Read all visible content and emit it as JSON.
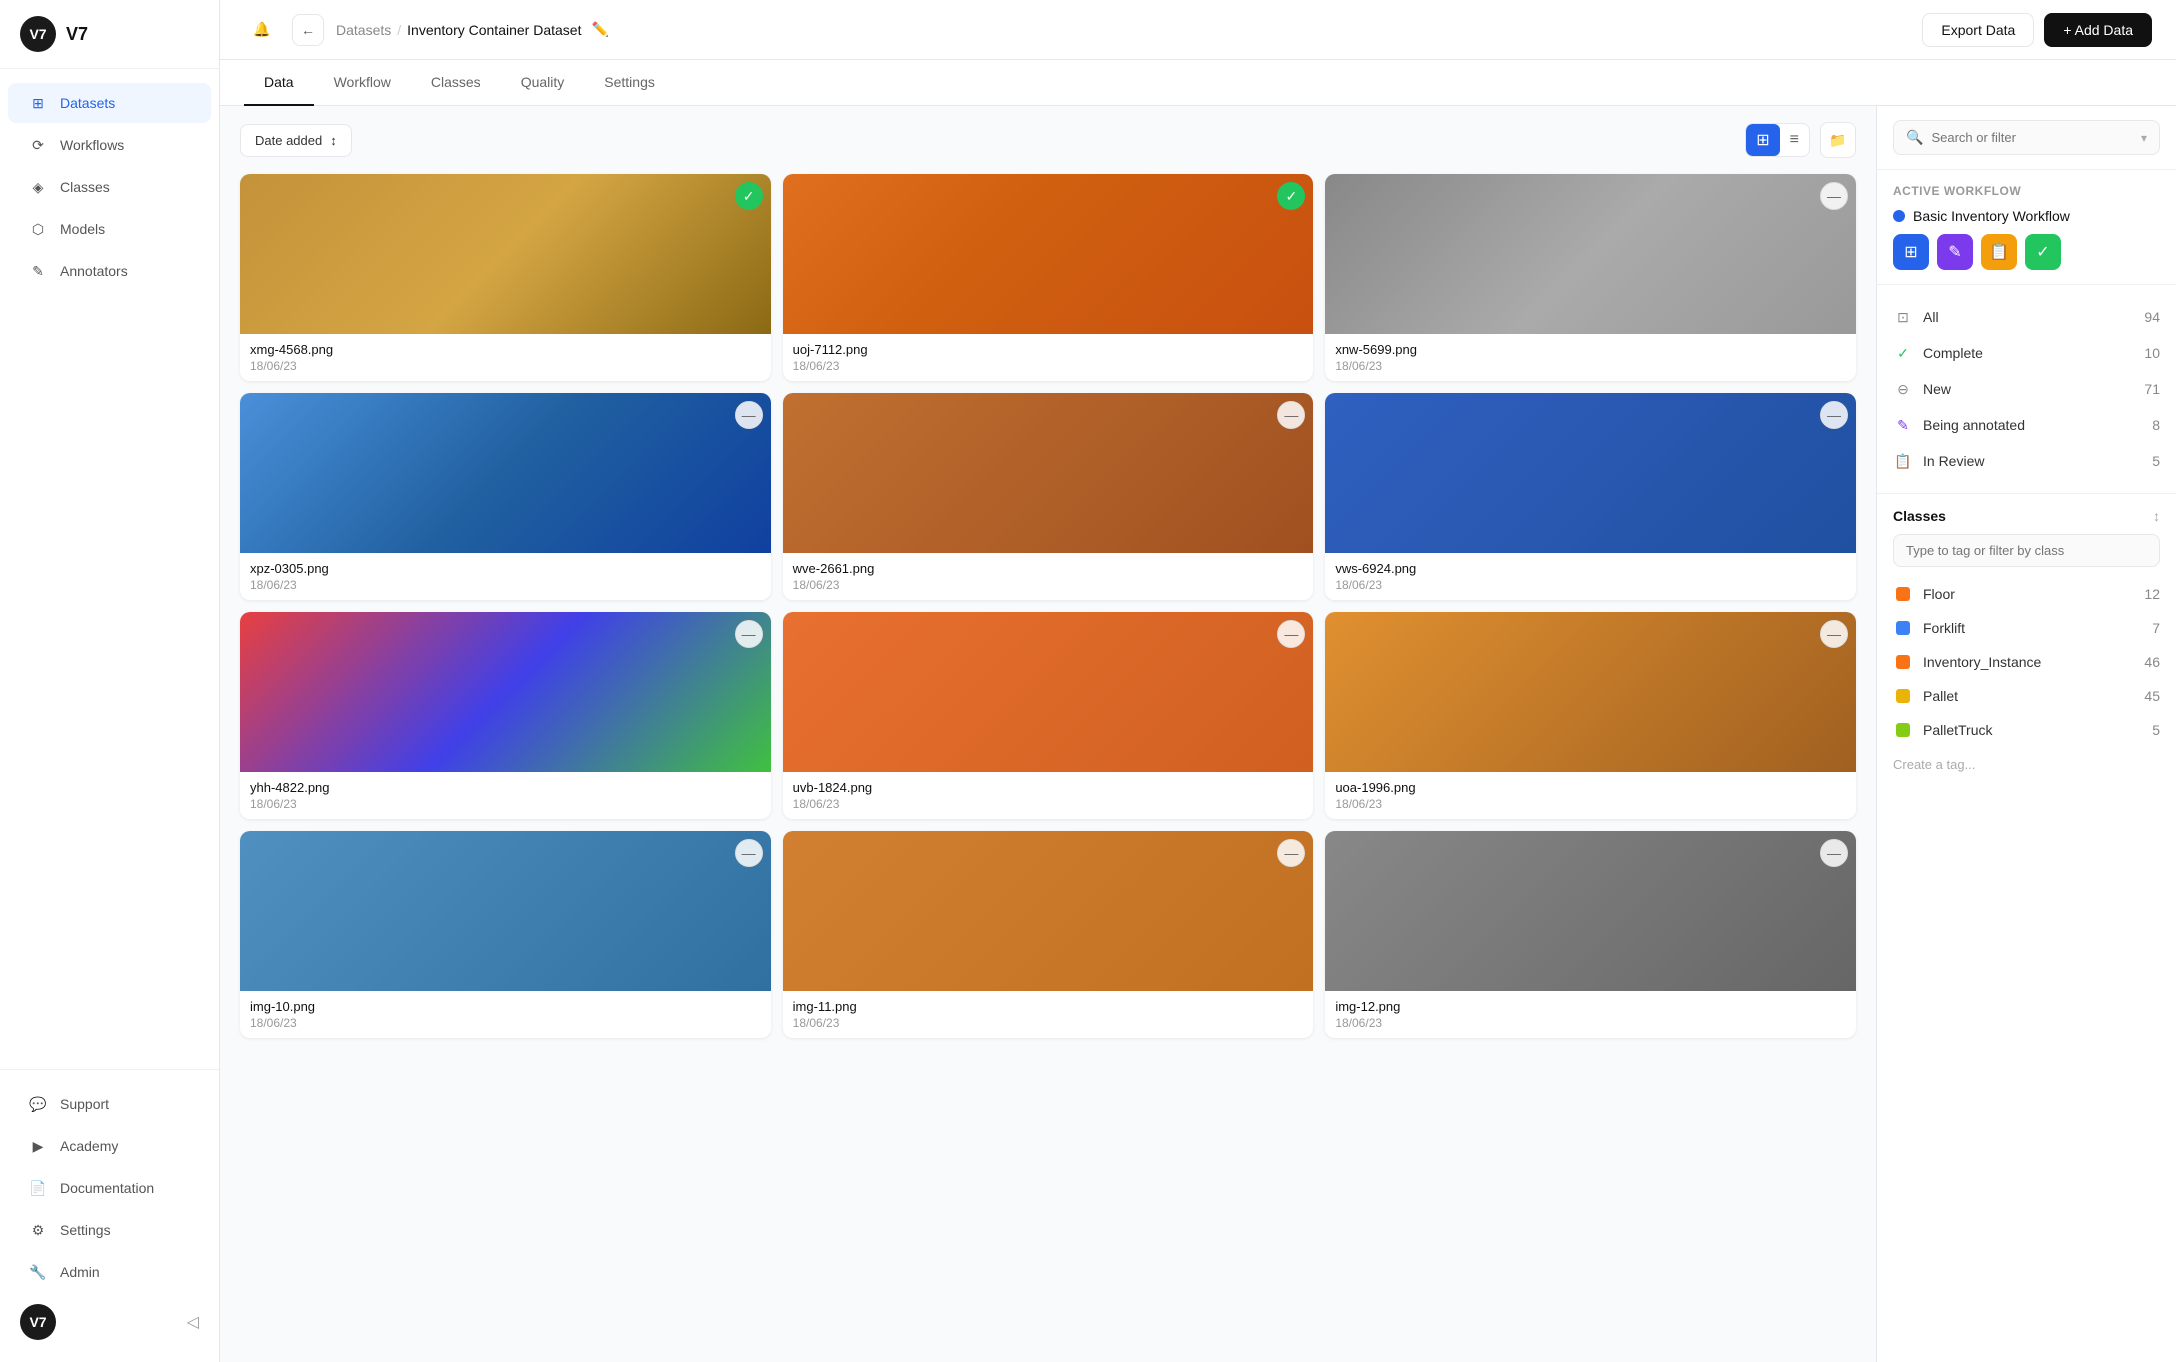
{
  "app": {
    "logo": "V7",
    "title": "V7"
  },
  "sidebar": {
    "nav_items": [
      {
        "id": "datasets",
        "label": "Datasets",
        "icon": "⊞",
        "active": true
      },
      {
        "id": "workflows",
        "label": "Workflows",
        "icon": "⟳"
      },
      {
        "id": "classes",
        "label": "Classes",
        "icon": "◈"
      },
      {
        "id": "models",
        "label": "Models",
        "icon": "⬡"
      },
      {
        "id": "annotators",
        "label": "Annotators",
        "icon": "✎"
      }
    ],
    "bottom_items": [
      {
        "id": "support",
        "label": "Support",
        "icon": "💬"
      },
      {
        "id": "academy",
        "label": "Academy",
        "icon": "▶"
      },
      {
        "id": "documentation",
        "label": "Documentation",
        "icon": "📄"
      },
      {
        "id": "settings",
        "label": "Settings",
        "icon": "⚙"
      },
      {
        "id": "admin",
        "label": "Admin",
        "icon": "🔧"
      }
    ],
    "footer_logo": "V7"
  },
  "header": {
    "breadcrumb_root": "Datasets",
    "breadcrumb_sep": "/",
    "dataset_name": "Inventory Container Dataset",
    "export_btn": "Export Data",
    "add_btn": "+ Add Data"
  },
  "tabs": [
    {
      "id": "data",
      "label": "Data",
      "active": true
    },
    {
      "id": "workflow",
      "label": "Workflow"
    },
    {
      "id": "classes",
      "label": "Classes"
    },
    {
      "id": "quality",
      "label": "Quality"
    },
    {
      "id": "settings",
      "label": "Settings"
    }
  ],
  "toolbar": {
    "sort_label": "Date added",
    "folder_icon": "folder-icon"
  },
  "images": [
    {
      "id": 1,
      "name": "xmg-4568.png",
      "date": "18/06/23",
      "badge": "check",
      "badge_type": "green",
      "bg": "img-boxes"
    },
    {
      "id": 2,
      "name": "uoj-7112.png",
      "date": "18/06/23",
      "badge": "check",
      "badge_type": "green",
      "bg": "img-containers"
    },
    {
      "id": 3,
      "name": "xnw-5699.png",
      "date": "18/06/23",
      "badge": "minus",
      "badge_type": "gray",
      "bg": "img-aerial"
    },
    {
      "id": 4,
      "name": "xpz-0305.png",
      "date": "18/06/23",
      "badge": "minus",
      "badge_type": "gray",
      "bg": "img-shelf"
    },
    {
      "id": 5,
      "name": "wve-2661.png",
      "date": "18/06/23",
      "badge": "minus",
      "badge_type": "gray",
      "bg": "img-boxes2"
    },
    {
      "id": 6,
      "name": "vws-6924.png",
      "date": "18/06/23",
      "badge": "minus",
      "badge_type": "gray",
      "bg": "img-warehouse"
    },
    {
      "id": 7,
      "name": "yhh-4822.png",
      "date": "18/06/23",
      "badge": "minus",
      "badge_type": "gray",
      "bg": "img-colorcontainers"
    },
    {
      "id": 8,
      "name": "uvb-1824.png",
      "date": "18/06/23",
      "badge": "minus",
      "badge_type": "gray",
      "bg": "img-containers2"
    },
    {
      "id": 9,
      "name": "uoa-1996.png",
      "date": "18/06/23",
      "badge": "minus",
      "badge_type": "gray",
      "bg": "img-warehouse2"
    },
    {
      "id": 10,
      "name": "img-10.png",
      "date": "18/06/23",
      "badge": "minus",
      "badge_type": "gray",
      "bg": "img-bottom1"
    },
    {
      "id": 11,
      "name": "img-11.png",
      "date": "18/06/23",
      "badge": "minus",
      "badge_type": "gray",
      "bg": "img-bottom2"
    },
    {
      "id": 12,
      "name": "img-12.png",
      "date": "18/06/23",
      "badge": "minus",
      "badge_type": "gray",
      "bg": "img-bottom3"
    }
  ],
  "right_panel": {
    "search_placeholder": "Search or filter",
    "active_workflow_label": "Active workflow",
    "workflow_name": "Basic Inventory Workflow",
    "workflow_icons": [
      "⊞",
      "✎",
      "📋",
      "✓"
    ],
    "status_items": [
      {
        "id": "all",
        "label": "All",
        "count": 94,
        "icon": "⊡",
        "icon_color": "#888"
      },
      {
        "id": "complete",
        "label": "Complete",
        "count": 10,
        "icon": "✓",
        "icon_color": "#22c55e"
      },
      {
        "id": "new",
        "label": "New",
        "count": 71,
        "icon": "⊖",
        "icon_color": "#888"
      },
      {
        "id": "being_annotated",
        "label": "Being annotated",
        "count": 8,
        "icon": "✎",
        "icon_color": "#7c3aed"
      },
      {
        "id": "in_review",
        "label": "In Review",
        "count": 5,
        "icon": "📋",
        "icon_color": "#f59e0b"
      }
    ],
    "classes_title": "Classes",
    "class_search_placeholder": "Type to tag or filter by class",
    "classes": [
      {
        "id": "floor",
        "name": "Floor",
        "count": 12,
        "color": "orange"
      },
      {
        "id": "forklift",
        "name": "Forklift",
        "count": 7,
        "color": "blue"
      },
      {
        "id": "inventory_instance",
        "name": "Inventory_Instance",
        "count": 46,
        "color": "orange"
      },
      {
        "id": "pallet",
        "name": "Pallet",
        "count": 45,
        "color": "yellow"
      },
      {
        "id": "pallet_truck",
        "name": "PalletTruck",
        "count": 5,
        "color": "lime"
      }
    ],
    "create_tag_label": "Create a tag..."
  }
}
